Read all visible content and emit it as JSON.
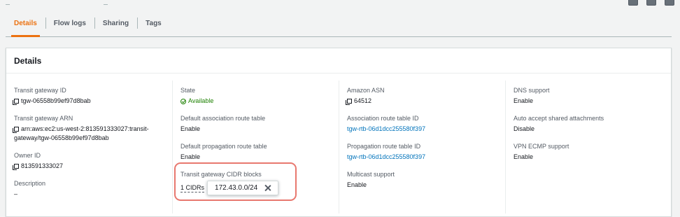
{
  "tabs": [
    {
      "label": "Details",
      "active": true
    },
    {
      "label": "Flow logs",
      "active": false
    },
    {
      "label": "Sharing",
      "active": false
    },
    {
      "label": "Tags",
      "active": false
    }
  ],
  "panel": {
    "title": "Details",
    "columns": [
      [
        {
          "label": "Transit gateway ID",
          "value": "tgw-06558b99ef97d8bab",
          "icon": "copy-icon"
        },
        {
          "label": "Transit gateway ARN",
          "value": "arn:aws:ec2:us-west-2:813591333027:transit-gateway/tgw-06558b99ef97d8bab",
          "icon": "copy-icon"
        },
        {
          "label": "Owner ID",
          "value": "813591333027",
          "icon": "copy-icon"
        },
        {
          "label": "Description",
          "value": "–"
        }
      ],
      [
        {
          "label": "State",
          "value": "Available",
          "icon": "check-circle-icon",
          "status_color": "#1d8102"
        },
        {
          "label": "Default association route table",
          "value": "Enable"
        },
        {
          "label": "Default propagation route table",
          "value": "Enable"
        },
        {
          "label": "Transit gateway CIDR blocks",
          "value": "1 CIDRs",
          "popover_value": "172.43.0.0/24"
        }
      ],
      [
        {
          "label": "Amazon ASN",
          "value": "64512",
          "icon": "copy-icon"
        },
        {
          "label": "Association route table ID",
          "value": "tgw-rtb-06d1dcc255580f397",
          "link": true
        },
        {
          "label": "Propagation route table ID",
          "value": "tgw-rtb-06d1dcc255580f397",
          "link": true
        },
        {
          "label": "Multicast support",
          "value": "Enable"
        }
      ],
      [
        {
          "label": "DNS support",
          "value": "Enable"
        },
        {
          "label": "Auto accept shared attachments",
          "value": "Disable"
        },
        {
          "label": "VPN ECMP support",
          "value": "Enable"
        }
      ]
    ]
  },
  "colors": {
    "accent": "#ec7211",
    "link": "#0073bb",
    "success": "#1d8102",
    "highlight": "#e8786f"
  }
}
